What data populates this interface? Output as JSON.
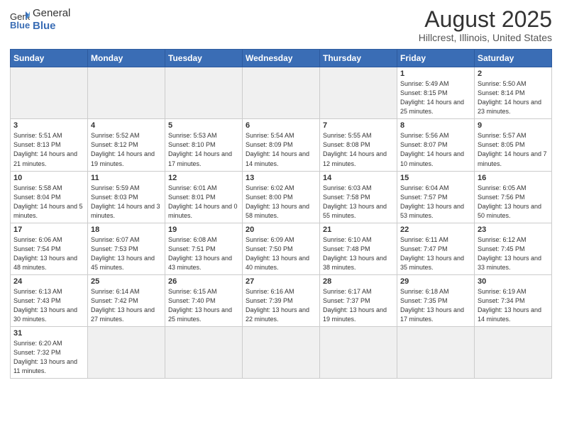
{
  "logo": {
    "text_general": "General",
    "text_blue": "Blue"
  },
  "title": "August 2025",
  "subtitle": "Hillcrest, Illinois, United States",
  "header_days": [
    "Sunday",
    "Monday",
    "Tuesday",
    "Wednesday",
    "Thursday",
    "Friday",
    "Saturday"
  ],
  "weeks": [
    [
      {
        "day": "",
        "info": ""
      },
      {
        "day": "",
        "info": ""
      },
      {
        "day": "",
        "info": ""
      },
      {
        "day": "",
        "info": ""
      },
      {
        "day": "",
        "info": ""
      },
      {
        "day": "1",
        "info": "Sunrise: 5:49 AM\nSunset: 8:15 PM\nDaylight: 14 hours\nand 25 minutes."
      },
      {
        "day": "2",
        "info": "Sunrise: 5:50 AM\nSunset: 8:14 PM\nDaylight: 14 hours\nand 23 minutes."
      }
    ],
    [
      {
        "day": "3",
        "info": "Sunrise: 5:51 AM\nSunset: 8:13 PM\nDaylight: 14 hours\nand 21 minutes."
      },
      {
        "day": "4",
        "info": "Sunrise: 5:52 AM\nSunset: 8:12 PM\nDaylight: 14 hours\nand 19 minutes."
      },
      {
        "day": "5",
        "info": "Sunrise: 5:53 AM\nSunset: 8:10 PM\nDaylight: 14 hours\nand 17 minutes."
      },
      {
        "day": "6",
        "info": "Sunrise: 5:54 AM\nSunset: 8:09 PM\nDaylight: 14 hours\nand 14 minutes."
      },
      {
        "day": "7",
        "info": "Sunrise: 5:55 AM\nSunset: 8:08 PM\nDaylight: 14 hours\nand 12 minutes."
      },
      {
        "day": "8",
        "info": "Sunrise: 5:56 AM\nSunset: 8:07 PM\nDaylight: 14 hours\nand 10 minutes."
      },
      {
        "day": "9",
        "info": "Sunrise: 5:57 AM\nSunset: 8:05 PM\nDaylight: 14 hours\nand 7 minutes."
      }
    ],
    [
      {
        "day": "10",
        "info": "Sunrise: 5:58 AM\nSunset: 8:04 PM\nDaylight: 14 hours\nand 5 minutes."
      },
      {
        "day": "11",
        "info": "Sunrise: 5:59 AM\nSunset: 8:03 PM\nDaylight: 14 hours\nand 3 minutes."
      },
      {
        "day": "12",
        "info": "Sunrise: 6:01 AM\nSunset: 8:01 PM\nDaylight: 14 hours\nand 0 minutes."
      },
      {
        "day": "13",
        "info": "Sunrise: 6:02 AM\nSunset: 8:00 PM\nDaylight: 13 hours\nand 58 minutes."
      },
      {
        "day": "14",
        "info": "Sunrise: 6:03 AM\nSunset: 7:58 PM\nDaylight: 13 hours\nand 55 minutes."
      },
      {
        "day": "15",
        "info": "Sunrise: 6:04 AM\nSunset: 7:57 PM\nDaylight: 13 hours\nand 53 minutes."
      },
      {
        "day": "16",
        "info": "Sunrise: 6:05 AM\nSunset: 7:56 PM\nDaylight: 13 hours\nand 50 minutes."
      }
    ],
    [
      {
        "day": "17",
        "info": "Sunrise: 6:06 AM\nSunset: 7:54 PM\nDaylight: 13 hours\nand 48 minutes."
      },
      {
        "day": "18",
        "info": "Sunrise: 6:07 AM\nSunset: 7:53 PM\nDaylight: 13 hours\nand 45 minutes."
      },
      {
        "day": "19",
        "info": "Sunrise: 6:08 AM\nSunset: 7:51 PM\nDaylight: 13 hours\nand 43 minutes."
      },
      {
        "day": "20",
        "info": "Sunrise: 6:09 AM\nSunset: 7:50 PM\nDaylight: 13 hours\nand 40 minutes."
      },
      {
        "day": "21",
        "info": "Sunrise: 6:10 AM\nSunset: 7:48 PM\nDaylight: 13 hours\nand 38 minutes."
      },
      {
        "day": "22",
        "info": "Sunrise: 6:11 AM\nSunset: 7:47 PM\nDaylight: 13 hours\nand 35 minutes."
      },
      {
        "day": "23",
        "info": "Sunrise: 6:12 AM\nSunset: 7:45 PM\nDaylight: 13 hours\nand 33 minutes."
      }
    ],
    [
      {
        "day": "24",
        "info": "Sunrise: 6:13 AM\nSunset: 7:43 PM\nDaylight: 13 hours\nand 30 minutes."
      },
      {
        "day": "25",
        "info": "Sunrise: 6:14 AM\nSunset: 7:42 PM\nDaylight: 13 hours\nand 27 minutes."
      },
      {
        "day": "26",
        "info": "Sunrise: 6:15 AM\nSunset: 7:40 PM\nDaylight: 13 hours\nand 25 minutes."
      },
      {
        "day": "27",
        "info": "Sunrise: 6:16 AM\nSunset: 7:39 PM\nDaylight: 13 hours\nand 22 minutes."
      },
      {
        "day": "28",
        "info": "Sunrise: 6:17 AM\nSunset: 7:37 PM\nDaylight: 13 hours\nand 19 minutes."
      },
      {
        "day": "29",
        "info": "Sunrise: 6:18 AM\nSunset: 7:35 PM\nDaylight: 13 hours\nand 17 minutes."
      },
      {
        "day": "30",
        "info": "Sunrise: 6:19 AM\nSunset: 7:34 PM\nDaylight: 13 hours\nand 14 minutes."
      }
    ],
    [
      {
        "day": "31",
        "info": "Sunrise: 6:20 AM\nSunset: 7:32 PM\nDaylight: 13 hours\nand 11 minutes."
      },
      {
        "day": "",
        "info": ""
      },
      {
        "day": "",
        "info": ""
      },
      {
        "day": "",
        "info": ""
      },
      {
        "day": "",
        "info": ""
      },
      {
        "day": "",
        "info": ""
      },
      {
        "day": "",
        "info": ""
      }
    ]
  ]
}
